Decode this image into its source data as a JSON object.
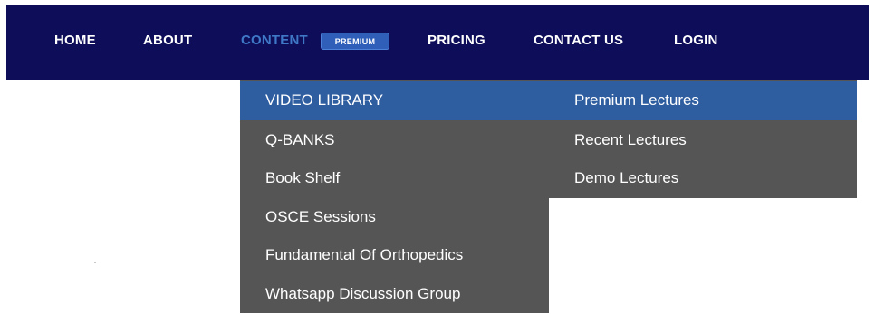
{
  "nav": {
    "home": "HOME",
    "about": "ABOUT",
    "content": "CONTENT",
    "premium_badge": "PREMIUM",
    "pricing": "PRICING",
    "contact": "CONTACT US",
    "login": "LOGIN"
  },
  "dropdown": {
    "items": [
      "VIDEO LIBRARY",
      "Q-BANKS",
      "Book Shelf",
      "OSCE Sessions",
      "Fundamental Of Orthopedics",
      "Whatsapp Discussion Group"
    ],
    "active_item": "VIDEO LIBRARY"
  },
  "submenu": {
    "items": [
      "Premium Lectures",
      "Recent Lectures",
      "Demo Lectures"
    ]
  },
  "colors": {
    "navbar_bg": "#0d0d59",
    "active_nav_text": "#3f78c6",
    "badge_bg": "#2f5fb8",
    "menu_bg": "#555555",
    "menu_highlight": "#2e5da0"
  }
}
